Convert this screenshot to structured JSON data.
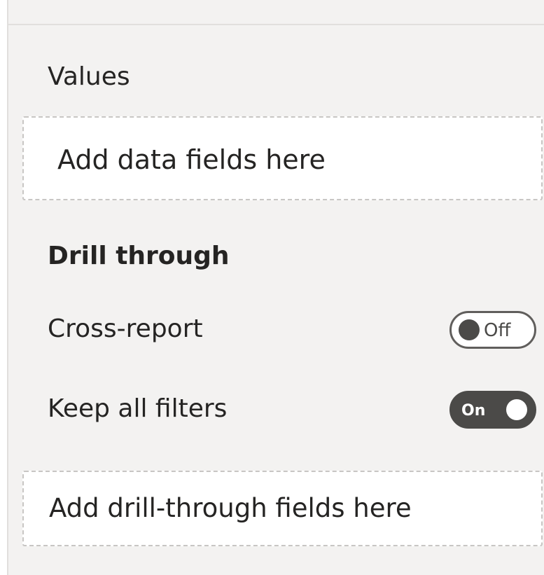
{
  "values": {
    "label": "Values",
    "well_placeholder": "Add data fields here"
  },
  "drill_through": {
    "label": "Drill through",
    "cross_report": {
      "label": "Cross-report",
      "state": "Off"
    },
    "keep_all_filters": {
      "label": "Keep all filters",
      "state": "On"
    },
    "well_placeholder": "Add drill-through fields here"
  },
  "colors": {
    "panel_background": "#f3f2f1",
    "toggle_on": "#4b4a48",
    "well_border": "#c8c6c4"
  }
}
